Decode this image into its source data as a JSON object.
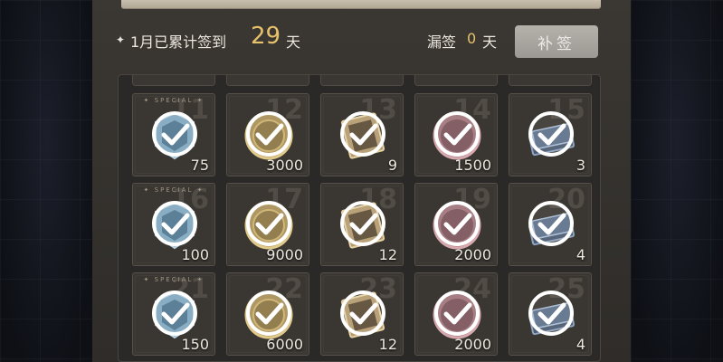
{
  "header": {
    "signin_prefix": "1月已累计签到",
    "signin_days": "29",
    "signin_unit": "天",
    "missed_label": "漏签",
    "missed_days": "0",
    "missed_unit": "天",
    "makeup_button_label": "补签"
  },
  "special_label": "SPECIAL",
  "rows": [
    [
      {
        "day": "11",
        "special": true,
        "item_icon": "shield-token-icon",
        "quantity": "75"
      },
      {
        "day": "12",
        "special": false,
        "item_icon": "gold-coin-icon",
        "quantity": "3000"
      },
      {
        "day": "13",
        "special": false,
        "item_icon": "material-card-icon",
        "quantity": "9"
      },
      {
        "day": "14",
        "special": false,
        "item_icon": "heart-medal-icon",
        "quantity": "1500"
      },
      {
        "day": "15",
        "special": false,
        "item_icon": "ticket-stack-icon",
        "quantity": "3"
      }
    ],
    [
      {
        "day": "16",
        "special": true,
        "item_icon": "shield-token-icon",
        "quantity": "100"
      },
      {
        "day": "17",
        "special": false,
        "item_icon": "gold-coin-icon",
        "quantity": "9000"
      },
      {
        "day": "18",
        "special": false,
        "item_icon": "material-card-icon",
        "quantity": "12"
      },
      {
        "day": "19",
        "special": false,
        "item_icon": "heart-medal-icon",
        "quantity": "2000"
      },
      {
        "day": "20",
        "special": false,
        "item_icon": "ticket-stack-icon",
        "quantity": "4"
      }
    ],
    [
      {
        "day": "21",
        "special": true,
        "item_icon": "shield-token-icon",
        "quantity": "150"
      },
      {
        "day": "22",
        "special": false,
        "item_icon": "gold-coin-icon",
        "quantity": "6000"
      },
      {
        "day": "23",
        "special": false,
        "item_icon": "material-card-icon",
        "quantity": "12"
      },
      {
        "day": "24",
        "special": false,
        "item_icon": "heart-medal-icon",
        "quantity": "2000"
      },
      {
        "day": "25",
        "special": false,
        "item_icon": "ticket-stack-icon",
        "quantity": "4"
      }
    ]
  ],
  "colors": {
    "accent_gold": "#e8c26a",
    "check_white": "#ffffff"
  }
}
